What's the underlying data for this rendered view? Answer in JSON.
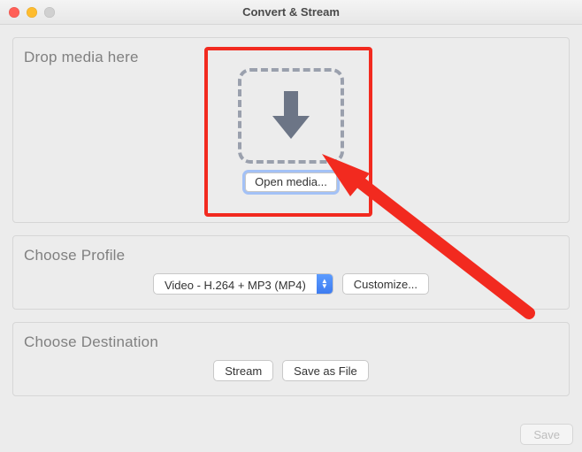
{
  "window": {
    "title": "Convert & Stream"
  },
  "drop": {
    "title": "Drop media here",
    "open_media_label": "Open media..."
  },
  "profile": {
    "title": "Choose Profile",
    "selected": "Video - H.264 + MP3 (MP4)",
    "customize_label": "Customize..."
  },
  "destination": {
    "title": "Choose Destination",
    "stream_label": "Stream",
    "save_as_file_label": "Save as File"
  },
  "footer": {
    "save_label": "Save"
  },
  "colors": {
    "annotation": "#f22a1f",
    "accent": "#3e7cf0"
  }
}
